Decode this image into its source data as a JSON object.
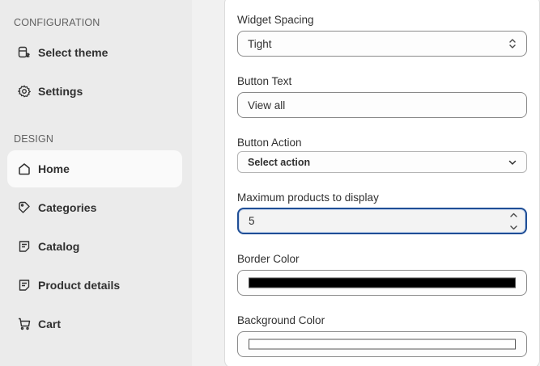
{
  "sidebar": {
    "sections": [
      {
        "label": "CONFIGURATION"
      },
      {
        "label": "DESIGN"
      }
    ],
    "items": [
      {
        "label": "Select theme",
        "icon": "theme-icon"
      },
      {
        "label": "Settings",
        "icon": "gear-icon"
      },
      {
        "label": "Home",
        "icon": "home-icon",
        "active": true
      },
      {
        "label": "Categories",
        "icon": "tag-icon"
      },
      {
        "label": "Catalog",
        "icon": "catalog-icon"
      },
      {
        "label": "Product details",
        "icon": "product-details-icon"
      },
      {
        "label": "Cart",
        "icon": "cart-icon"
      }
    ]
  },
  "form": {
    "widget_spacing": {
      "label": "Widget Spacing",
      "value": "Tight"
    },
    "button_text": {
      "label": "Button Text",
      "value": "View all"
    },
    "button_action": {
      "label": "Button Action",
      "value": "Select action"
    },
    "max_products": {
      "label": "Maximum products to display",
      "value": "5"
    },
    "border_color": {
      "label": "Border Color",
      "value": "#000000"
    },
    "background_color": {
      "label": "Background Color",
      "value": "#ffffff"
    }
  },
  "colors": {
    "focus_ring": "#1f4e96",
    "active_nav_bg": "#fafafa",
    "sidebar_bg": "#ebebeb"
  }
}
